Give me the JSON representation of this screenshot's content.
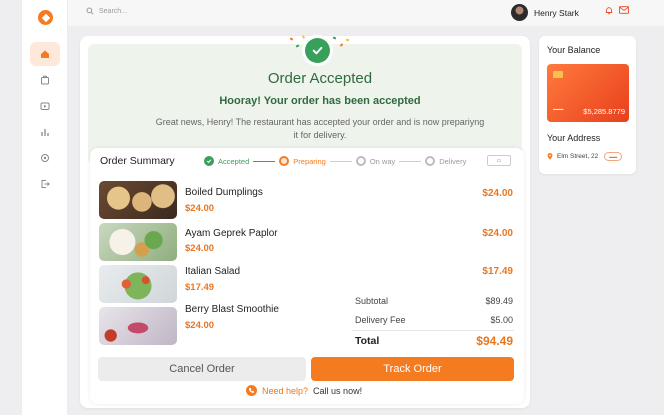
{
  "search": {
    "placeholder": "Search..."
  },
  "user": {
    "name": "Henry Stark"
  },
  "status": {
    "title": "Order Accepted",
    "subtitle": "Hooray! Your order has been accepted",
    "message_line1": "Great news, Henry! The restaurant has accepted your order and is now prepariyng",
    "message_line2": "it for delivery."
  },
  "summary": {
    "title": "Order Summary",
    "steps": [
      {
        "label": "Accepted",
        "state": "done"
      },
      {
        "label": "Preparing",
        "state": "active"
      },
      {
        "label": "On way",
        "state": "pending"
      },
      {
        "label": "Delivery",
        "state": "pending"
      }
    ],
    "items": [
      {
        "name": "Boiled Dumplings",
        "price": "$24.00",
        "total": "$24.00"
      },
      {
        "name": "Ayam Geprek Paplor",
        "price": "$24.00",
        "total": "$24.00"
      },
      {
        "name": "Italian Salad",
        "price": "$17.49",
        "total": "$17.49"
      },
      {
        "name": "Berry Blast Smoothie",
        "price": "$24.00",
        "total": ""
      }
    ],
    "subtotal_label": "Subtotal",
    "subtotal_value": "$89.49",
    "fee_label": "Delivery Fee",
    "fee_value": "$5.00",
    "total_label": "Total",
    "total_value": "$94.49"
  },
  "actions": {
    "cancel": "Cancel Order",
    "track": "Track Order",
    "help_link": "Need help?",
    "help_text": "Call us now!"
  },
  "balance": {
    "title": "Your Balance",
    "amount": "$5,285.8779"
  },
  "address": {
    "title": "Your Address",
    "street": "Elm Street, 22"
  },
  "colors": {
    "accent": "#f47b20",
    "success": "#38a05a",
    "success_text": "#2f6b3e",
    "price": "#e87722"
  },
  "icons": [
    "logo-icon",
    "home-icon",
    "orders-icon",
    "video-icon",
    "chart-icon",
    "settings-icon",
    "logout-icon",
    "search-icon",
    "bell-icon",
    "mail-icon",
    "check-icon",
    "phone-icon",
    "pin-icon"
  ]
}
